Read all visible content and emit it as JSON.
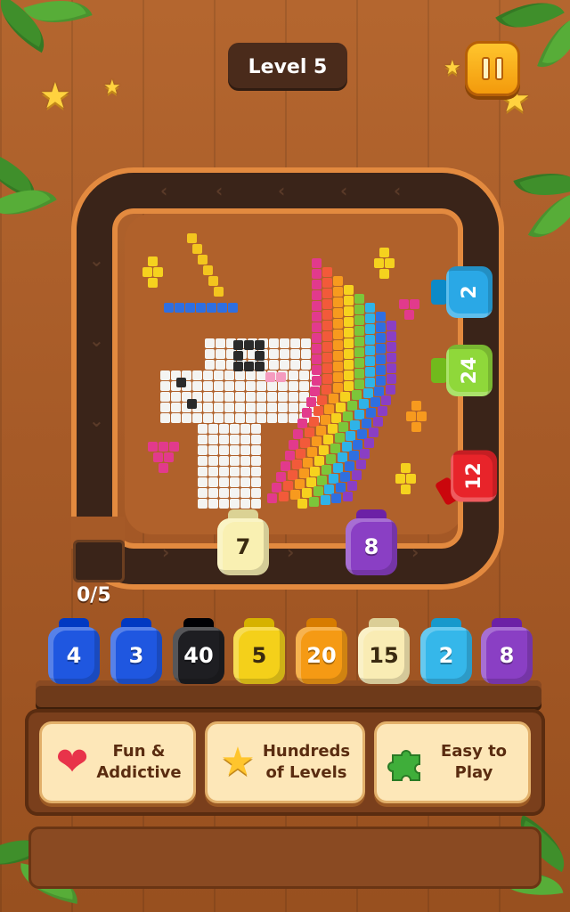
{
  "header": {
    "level_label": "Level 5"
  },
  "progress": {
    "counter": "0/5"
  },
  "track_jars": [
    {
      "value": "7",
      "color": "#f9f0b2"
    },
    {
      "value": "8",
      "color": "#8a3fc4"
    }
  ],
  "side_jars": [
    {
      "value": "2",
      "color": "#2aa8e6"
    },
    {
      "value": "24",
      "color": "#8fd83a"
    },
    {
      "value": "12",
      "color": "#e8242a"
    }
  ],
  "tray_jars": [
    {
      "value": "4",
      "color": "#1f57e0"
    },
    {
      "value": "3",
      "color": "#1f57e0"
    },
    {
      "value": "40",
      "color": "#1e1e22"
    },
    {
      "value": "5",
      "color": "#f4d01a"
    },
    {
      "value": "20",
      "color": "#f59a14"
    },
    {
      "value": "15",
      "color": "#f9ecb4"
    },
    {
      "value": "2",
      "color": "#35b7ea"
    },
    {
      "value": "8",
      "color": "#8a3fc4"
    }
  ],
  "features": [
    {
      "label": "Fun &\nAddictive",
      "icon": "heart-icon"
    },
    {
      "label": "Hundreds\nof Levels",
      "icon": "star-icon"
    },
    {
      "label": "Easy to\nPlay",
      "icon": "puzzle-icon"
    }
  ],
  "colors": {
    "wood": "#a65a27",
    "track": "#3a2419",
    "track_border": "#e38a3f",
    "accent": "#ffc52d"
  }
}
